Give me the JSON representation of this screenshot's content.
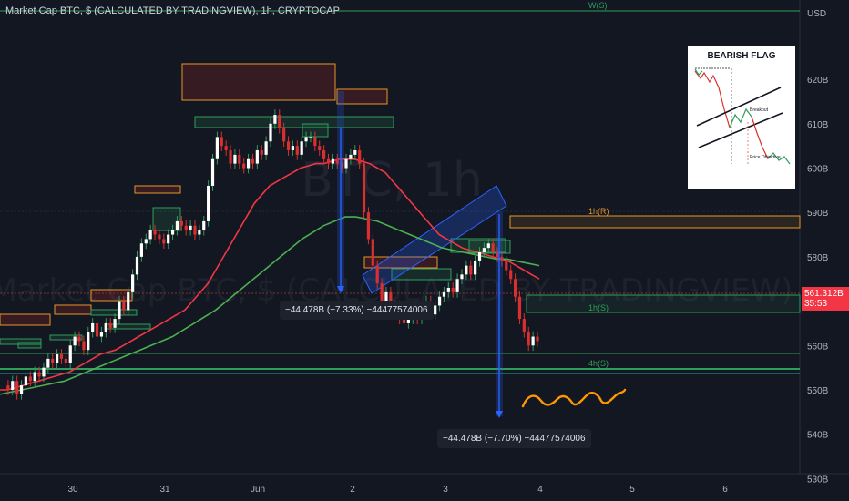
{
  "header": {
    "title": "Market Cap BTC, $ (CALCULATED BY TRADINGVIEW), 1h, CRYPTOCAP"
  },
  "watermark": {
    "big": "BTC, 1h",
    "sub": "Market Cap BTC, $ (CALCULATED BY TRADINGVIEW)"
  },
  "price_scale": {
    "currency": "USD"
  },
  "last_price": {
    "value": "561.312B",
    "countdown": "35:53",
    "color": "#f23645"
  },
  "measurements": [
    {
      "label": "−44.478B (−7.33%) −44477574006"
    },
    {
      "label": "−44.478B (−7.70%) −44477574006"
    }
  ],
  "zone_labels": [
    {
      "text": "W(S)",
      "color": "#2f9e5b"
    },
    {
      "text": "1h(R)",
      "color": "#f0a030"
    },
    {
      "text": "1h(S)",
      "color": "#2f9e5b"
    },
    {
      "text": "4h(S)",
      "color": "#2f9e5b"
    }
  ],
  "inset": {
    "title": "BEARISH FLAG",
    "labels": [
      "Breakout",
      "Price Objective"
    ]
  },
  "colors": {
    "background": "#131722",
    "up": "#2f9e5b",
    "down": "#d9302f",
    "support_zone": "#2f9e5b",
    "resistance_zone": "#e8952b",
    "flag_channel": "#2962ff",
    "ma_fast": "#f23645",
    "ma_slow": "#4caf50",
    "squiggle": "#ff9800"
  },
  "chart_data": {
    "type": "candlestick",
    "title": "Market Cap BTC, $ (CALCULATED BY TRADINGVIEW), 1h, CRYPTOCAP",
    "x_ticks": [
      "30",
      "31",
      "Jun",
      "2",
      "3",
      "4",
      "5",
      "6"
    ],
    "y_ticks": [
      "530B",
      "540B",
      "550B",
      "560B",
      "570B",
      "580B",
      "590B",
      "600B",
      "610B",
      "620B"
    ],
    "ylim": [
      527,
      628
    ],
    "grid": false,
    "series": [
      {
        "name": "",
        "kind": "candles",
        "values": [
          551,
          550,
          552,
          549,
          551,
          553,
          552,
          554,
          553,
          555,
          557,
          556,
          558,
          557,
          556,
          560,
          562,
          561,
          559,
          563,
          565,
          562,
          563,
          565,
          564,
          566,
          570,
          568,
          572,
          576,
          580,
          583,
          584,
          586,
          585,
          584,
          583,
          585,
          586,
          588,
          587,
          586,
          587,
          585,
          586,
          588,
          596,
          602,
          607,
          605,
          604,
          601,
          603,
          601,
          600,
          602,
          601,
          604,
          603,
          606,
          610,
          612,
          609,
          606,
          604,
          605,
          603,
          606,
          607,
          607,
          605,
          604,
          602,
          601,
          602,
          601,
          600,
          602,
          603,
          604,
          601,
          590,
          584,
          578,
          574,
          570,
          572,
          568,
          569,
          566,
          565,
          566,
          567,
          566,
          568,
          570,
          567,
          569,
          571,
          572,
          573,
          572,
          575,
          576,
          578,
          576,
          579,
          581,
          582,
          583,
          581,
          580,
          579,
          577,
          575,
          571,
          566,
          563,
          560,
          562,
          561
        ]
      },
      {
        "name": "",
        "kind": "ma_fast",
        "values": [
          550,
          550,
          550.5,
          551,
          551.5,
          552,
          552.5,
          553,
          553.5,
          554,
          555,
          556,
          557,
          558,
          558.5,
          559,
          560,
          561,
          562,
          563,
          564,
          565,
          566,
          567,
          568,
          570,
          572,
          574,
          577,
          580,
          583,
          586,
          589,
          592,
          594,
          596,
          597,
          598,
          599,
          600,
          600.5,
          601,
          601,
          601.5,
          602,
          602,
          602,
          601.5,
          601,
          600,
          599,
          597,
          595,
          593,
          591,
          589,
          587,
          585,
          584,
          583,
          582,
          581.5,
          581,
          580.5,
          580,
          579.5,
          579,
          578,
          577,
          576,
          575
        ]
      },
      {
        "name": "",
        "kind": "ma_slow",
        "values": [
          549,
          549.5,
          550,
          550.5,
          551,
          551.5,
          552,
          553,
          554,
          555,
          556,
          557,
          558,
          559,
          560,
          561,
          562,
          563.5,
          565,
          566.5,
          568,
          570,
          572,
          574,
          576,
          578,
          580,
          582,
          584,
          585.5,
          587,
          588,
          589,
          589,
          588.5,
          588,
          587,
          586,
          585,
          584,
          583,
          582,
          581.5,
          581,
          580.5,
          580,
          579.5,
          579.5,
          579,
          578.5,
          578
        ]
      }
    ],
    "horizontal_zones": [
      {
        "label": "W(S)",
        "value": 627.5
      },
      {
        "label": "1h(R)",
        "from": 576.5,
        "to": 578.2
      },
      {
        "label": "1h(S)",
        "from": 557.5,
        "to": 561.2
      },
      {
        "label": "4h(S)",
        "from": 543.8,
        "to": 547.5
      }
    ]
  }
}
